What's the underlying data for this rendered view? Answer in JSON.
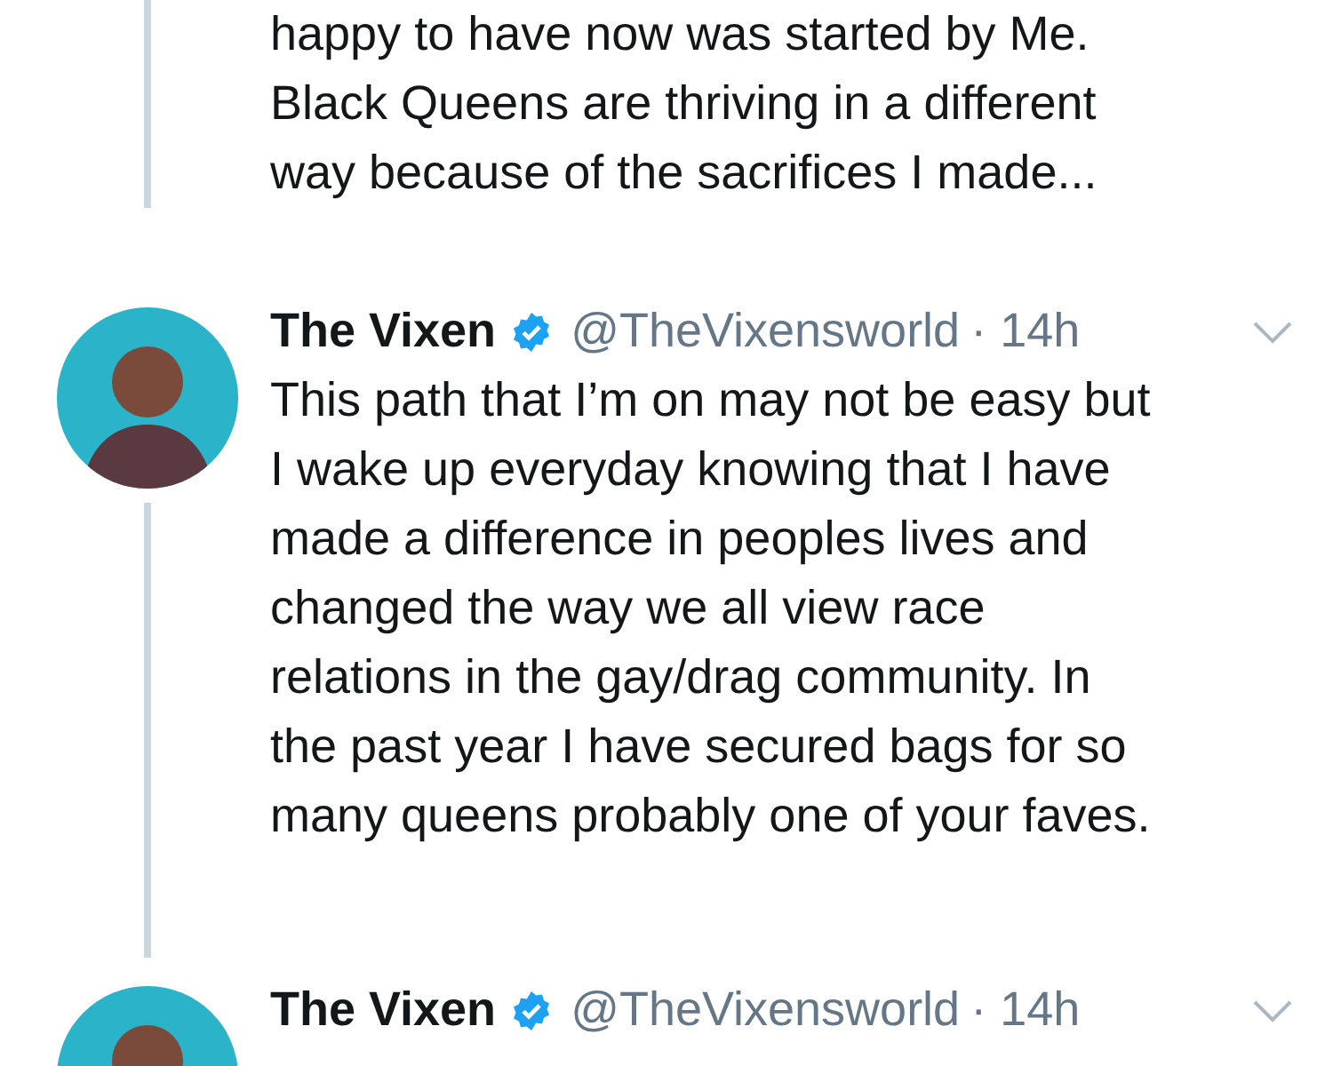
{
  "previous_tweet": {
    "lines": [
      "happy to have now was started by Me.",
      "Black Queens are thriving in a different",
      "way because of the sacrifices I made..."
    ]
  },
  "tweets": [
    {
      "name": "The Vixen",
      "verified": true,
      "handle": "@TheVixensworld",
      "time": "· 14h",
      "lines": [
        "This path that I’m on may not be easy but",
        "I wake up everyday knowing that I have",
        "made a difference in peoples lives and",
        "changed the way we all view race",
        "relations in the gay/drag community. In",
        "the past year I have secured bags for so",
        "many queens probably one of your faves."
      ]
    },
    {
      "name": "The Vixen",
      "verified": true,
      "handle": "@TheVixensworld",
      "time": "· 14h"
    }
  ]
}
